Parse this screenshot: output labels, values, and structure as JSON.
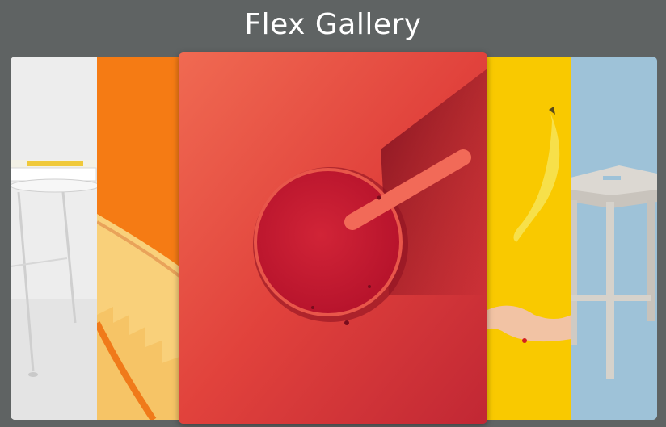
{
  "header": {
    "title": "Flex Gallery"
  },
  "gallery": {
    "panels": [
      {
        "subject": "white-stool",
        "active": false
      },
      {
        "subject": "orange-staircase",
        "active": false
      },
      {
        "subject": "red-smoothie",
        "active": true
      },
      {
        "subject": "banana-hand",
        "active": false
      },
      {
        "subject": "wooden-stool",
        "active": false
      }
    ]
  },
  "colors": {
    "background": "#5f6363",
    "title": "#ffffff"
  }
}
